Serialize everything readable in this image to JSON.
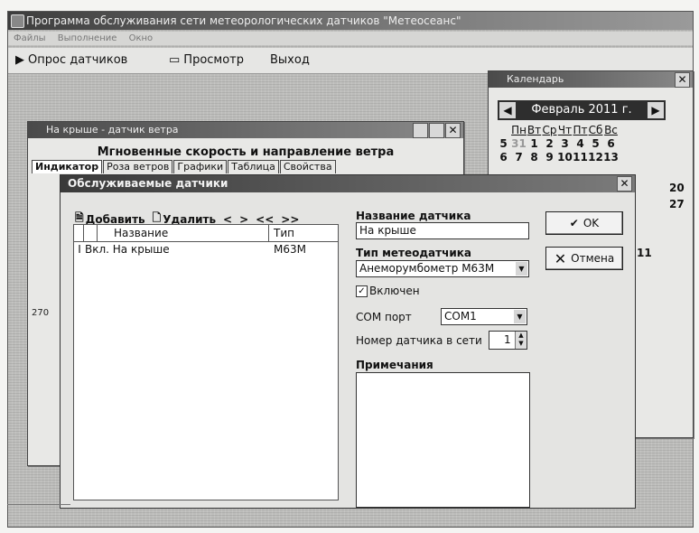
{
  "app": {
    "title": "Программа обслуживания сети метеорологических датчиков \"Метеосеанс\"",
    "menu": [
      "Файлы",
      "Выполнение",
      "Окно"
    ]
  },
  "toolbar": {
    "poll_label": "Опрос датчиков",
    "view_label": "Просмотр",
    "exit_label": "Выход"
  },
  "calendar": {
    "title": "Календарь",
    "month_label": "Февраль 2011 г.",
    "weekdays": [
      "Пн",
      "Вт",
      "Ср",
      "Чт",
      "Пт",
      "Сб",
      "Вс"
    ],
    "rows": [
      [
        "5",
        "31",
        "1",
        "2",
        "3",
        "4",
        "5",
        "6"
      ],
      [
        "6",
        "7",
        "8",
        "9",
        "10",
        "11",
        "12",
        "13"
      ]
    ],
    "right_col": [
      "20",
      "27",
      "11"
    ]
  },
  "wind_window": {
    "title": "На крыше - датчик ветра",
    "heading": "Мгновенные скорость и направление ветра",
    "tabs": [
      "Индикатор",
      "Роза ветров",
      "Графики",
      "Таблица",
      "Свойства"
    ],
    "side_label": "270"
  },
  "dialog": {
    "title": "Обслуживаемые датчики",
    "toolbar": {
      "add": "Добавить",
      "delete": "Удалить",
      "nav": [
        "<",
        ">",
        "<<",
        ">>"
      ]
    },
    "columns": [
      "Название",
      "Тип"
    ],
    "rows": [
      {
        "marker": "I",
        "name": "Вкл. На крыше",
        "type": "М63М"
      }
    ],
    "name_label": "Название датчика",
    "name_value": "На крыше",
    "type_label": "Тип метеодатчика",
    "type_value": "Анеморумбометр М63М",
    "enabled_label": "Включен",
    "enabled": true,
    "port_label": "COM порт",
    "port_value": "COM1",
    "netnum_label": "Номер датчика в сети",
    "netnum_value": "1",
    "notes_label": "Примечания",
    "ok_label": "OK",
    "cancel_label": "Отмена"
  }
}
